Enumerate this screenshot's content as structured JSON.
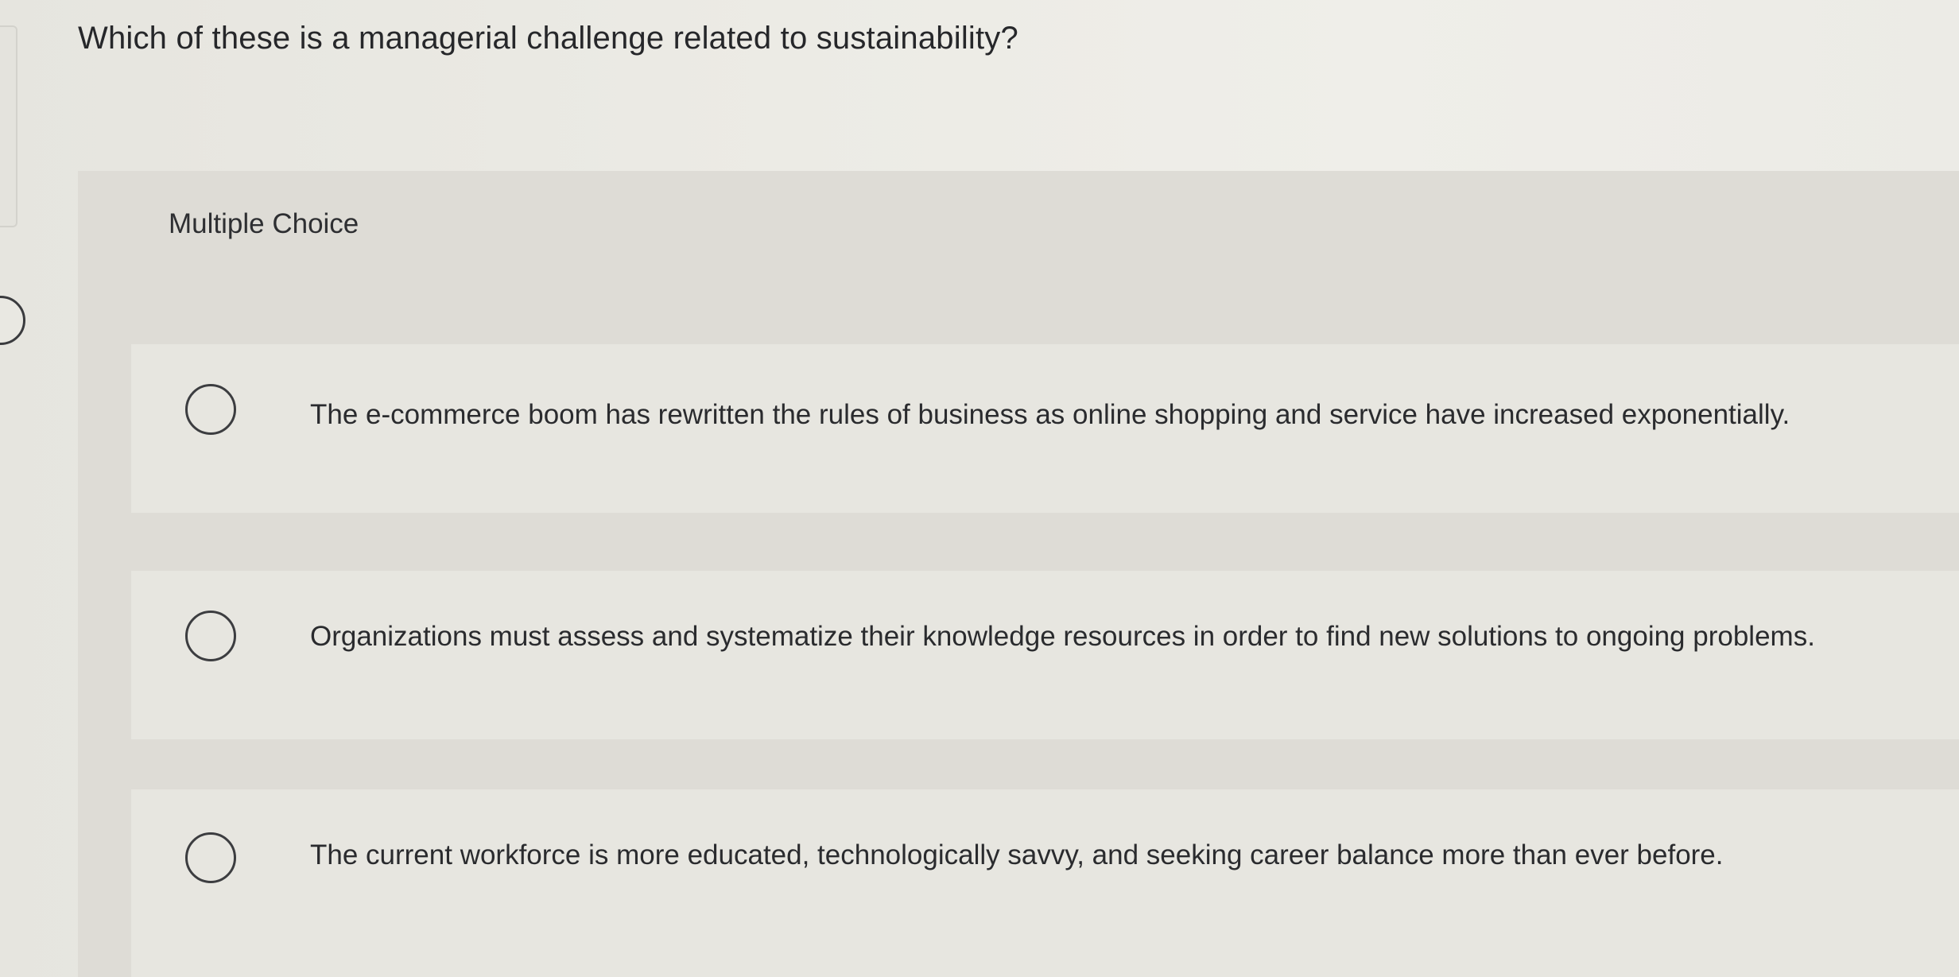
{
  "question": {
    "text": "Which of these is a managerial challenge related to sustainability?"
  },
  "question_type": "Multiple Choice",
  "options": [
    {
      "text": "The e-commerce boom has rewritten the rules of business as online shopping and service have increased exponentially.",
      "selected": false
    },
    {
      "text": "Organizations must assess and systematize their knowledge resources in order to find new solutions to ongoing problems.",
      "selected": false
    },
    {
      "text": "The current workforce is more educated, technologically savvy, and seeking career balance more than ever before.",
      "selected": false
    }
  ]
}
